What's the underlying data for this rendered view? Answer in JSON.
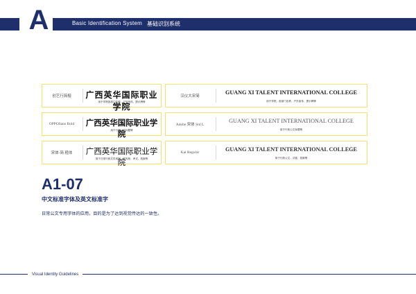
{
  "header": {
    "letter": "A",
    "title_en": "Basic Identification System",
    "title_cn": "基础识别系统"
  },
  "cards": [
    {
      "font_name": "创艺行简楷",
      "sample": "广西英华国际职业学院",
      "usage": "用于学院各部门名称，户外宣传，提示牌等"
    },
    {
      "font_name": "汉仪大宋简",
      "sample": "GUANG XI TALENT INTERNATIONAL COLLEGE",
      "usage": "用于学院，各部门名称，户外宣传，提示牌等"
    },
    {
      "font_name": "OPPOSans Bold",
      "sample": "广西英华国际职业学院",
      "usage": "用于行政公文标题等"
    },
    {
      "font_name": "Adobe 宋体 Std L",
      "sample": "GUANG XI TALENT INTERNATIONAL COLLEGE",
      "usage": "用于行政公文标题等"
    },
    {
      "font_name": "宋体-简 粗体",
      "sample": "广西英华国际职业学院",
      "usage": "用于日常行政文件用字，宣传册，考试，档案等"
    },
    {
      "font_name": "Kai Regular",
      "sample": "GUANG XI TALENT INTERNATIONAL COLLEGE",
      "usage": "用于行政公文，试卷，档案等"
    }
  ],
  "section": {
    "code": "A1-07",
    "subtitle": "中文标准字体及英文标准字",
    "description": "日常公文专用字体的应用，目的是为了达到视觉传达的一致性。"
  },
  "footer": {
    "label": "Visual Identity Guidelines"
  },
  "colors": {
    "navy": "#1e2f6b",
    "card_border": "#f4e36a"
  }
}
